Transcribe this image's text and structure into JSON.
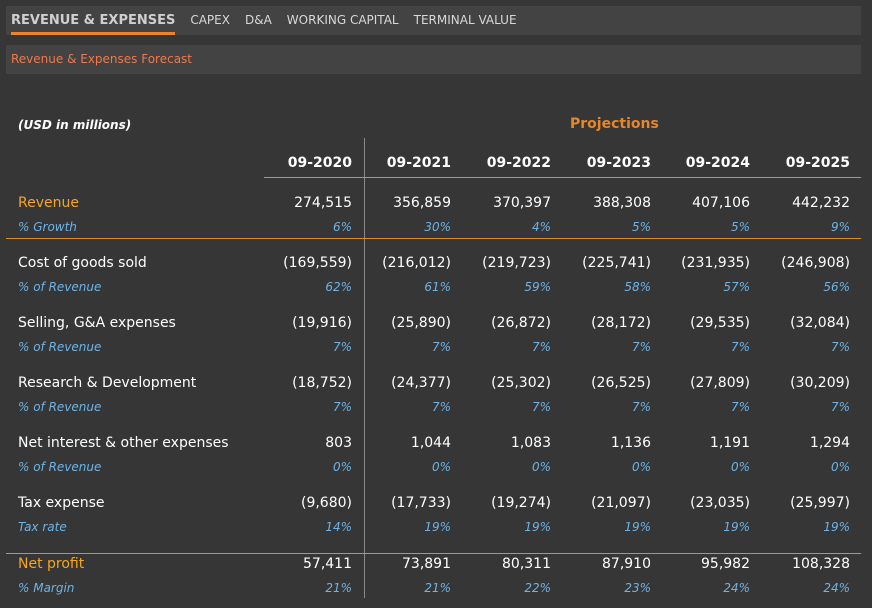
{
  "tabs": [
    {
      "label": "REVENUE & EXPENSES",
      "active": true
    },
    {
      "label": "CAPEX",
      "active": false
    },
    {
      "label": "D&A",
      "active": false
    },
    {
      "label": "WORKING CAPITAL",
      "active": false
    },
    {
      "label": "TERMINAL VALUE",
      "active": false
    }
  ],
  "section_title": "Revenue & Expenses Forecast",
  "units_label": "(USD in millions)",
  "projections_label": "Projections",
  "colors": {
    "accent": "#e8862a",
    "highlight": "#f5a623",
    "ratio": "#6db3e6",
    "background": "#363636"
  },
  "columns": [
    "09-2020",
    "09-2021",
    "09-2022",
    "09-2023",
    "09-2024",
    "09-2025"
  ],
  "rows": [
    {
      "label": "Revenue",
      "values": [
        "274,515",
        "356,859",
        "370,397",
        "388,308",
        "407,106",
        "442,232"
      ],
      "sub_label": "% Growth",
      "sub_values": [
        "6%",
        "30%",
        "4%",
        "5%",
        "5%",
        "9%"
      ]
    },
    {
      "label": "Cost of goods sold",
      "values": [
        "(169,559)",
        "(216,012)",
        "(219,723)",
        "(225,741)",
        "(231,935)",
        "(246,908)"
      ],
      "sub_label": "% of Revenue",
      "sub_values": [
        "62%",
        "61%",
        "59%",
        "58%",
        "57%",
        "56%"
      ]
    },
    {
      "label": "Selling, G&A expenses",
      "values": [
        "(19,916)",
        "(25,890)",
        "(26,872)",
        "(28,172)",
        "(29,535)",
        "(32,084)"
      ],
      "sub_label": "% of Revenue",
      "sub_values": [
        "7%",
        "7%",
        "7%",
        "7%",
        "7%",
        "7%"
      ]
    },
    {
      "label": "Research & Development",
      "values": [
        "(18,752)",
        "(24,377)",
        "(25,302)",
        "(26,525)",
        "(27,809)",
        "(30,209)"
      ],
      "sub_label": "% of Revenue",
      "sub_values": [
        "7%",
        "7%",
        "7%",
        "7%",
        "7%",
        "7%"
      ]
    },
    {
      "label": "Net interest & other expenses",
      "values": [
        "803",
        "1,044",
        "1,083",
        "1,136",
        "1,191",
        "1,294"
      ],
      "sub_label": "% of Revenue",
      "sub_values": [
        "0%",
        "0%",
        "0%",
        "0%",
        "0%",
        "0%"
      ]
    },
    {
      "label": "Tax expense",
      "values": [
        "(9,680)",
        "(17,733)",
        "(19,274)",
        "(21,097)",
        "(23,035)",
        "(25,997)"
      ],
      "sub_label": "Tax rate",
      "sub_values": [
        "14%",
        "19%",
        "19%",
        "19%",
        "19%",
        "19%"
      ]
    },
    {
      "label": "Net profit",
      "values": [
        "57,411",
        "73,891",
        "80,311",
        "87,910",
        "95,982",
        "108,328"
      ],
      "sub_label": "% Margin",
      "sub_values": [
        "21%",
        "21%",
        "22%",
        "23%",
        "24%",
        "24%"
      ]
    }
  ]
}
